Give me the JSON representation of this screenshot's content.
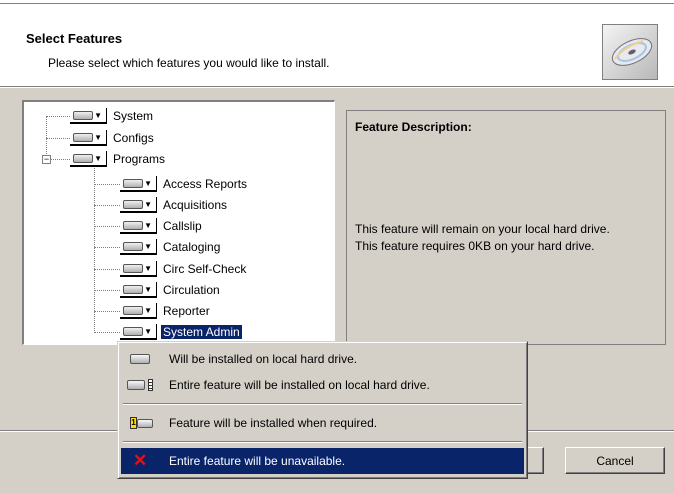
{
  "header": {
    "title": "Select Features",
    "subtitle": "Please select which features you would like to install."
  },
  "tree": {
    "items": [
      {
        "label": "System",
        "selected": false
      },
      {
        "label": "Configs",
        "selected": false
      },
      {
        "label": "Programs",
        "selected": false,
        "expanded": true,
        "children": [
          {
            "label": "Access Reports"
          },
          {
            "label": "Acquisitions"
          },
          {
            "label": "Callslip"
          },
          {
            "label": "Cataloging"
          },
          {
            "label": "Circ Self-Check"
          },
          {
            "label": "Circulation"
          },
          {
            "label": "Reporter"
          },
          {
            "label": "System Admin",
            "selected": true
          }
        ]
      }
    ],
    "expander_symbol": "−"
  },
  "description": {
    "title": "Feature Description:",
    "line1": "This feature will remain on your local hard drive.",
    "line2": "This feature requires 0KB on your hard drive."
  },
  "context_menu": {
    "items": [
      {
        "label": "Will be installed on local hard drive.",
        "icon": "hard-drive-icon"
      },
      {
        "label": "Entire feature will be installed on local hard drive.",
        "icon": "hard-drive-stack-icon"
      },
      {
        "label": "Feature will be installed when required.",
        "icon": "install-on-demand-icon"
      },
      {
        "label": "Entire feature will be unavailable.",
        "icon": "unavailable-x-icon",
        "highlighted": true
      }
    ]
  },
  "buttons": {
    "cancel": "Cancel"
  },
  "glyphs": {
    "dropdown_arrow": "▼",
    "x_mark": "✕",
    "req_number": "1"
  },
  "colors": {
    "selection": "#0a246a",
    "dialog_bg": "#d4d0c8"
  }
}
